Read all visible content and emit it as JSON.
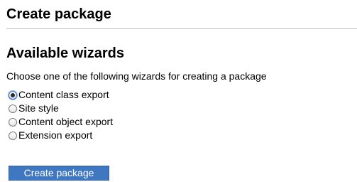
{
  "page": {
    "title": "Create package"
  },
  "wizards": {
    "heading": "Available wizards",
    "description": "Choose one of the following wizards for creating a package",
    "options": [
      {
        "label": "Content class export",
        "selected": true
      },
      {
        "label": "Site style",
        "selected": false
      },
      {
        "label": "Content object export",
        "selected": false
      },
      {
        "label": "Extension export",
        "selected": false
      }
    ],
    "submit_label": "Create package"
  },
  "colors": {
    "button_background": "#3f77c0",
    "button_text": "#ffffff",
    "divider": "#bdbdbd"
  }
}
